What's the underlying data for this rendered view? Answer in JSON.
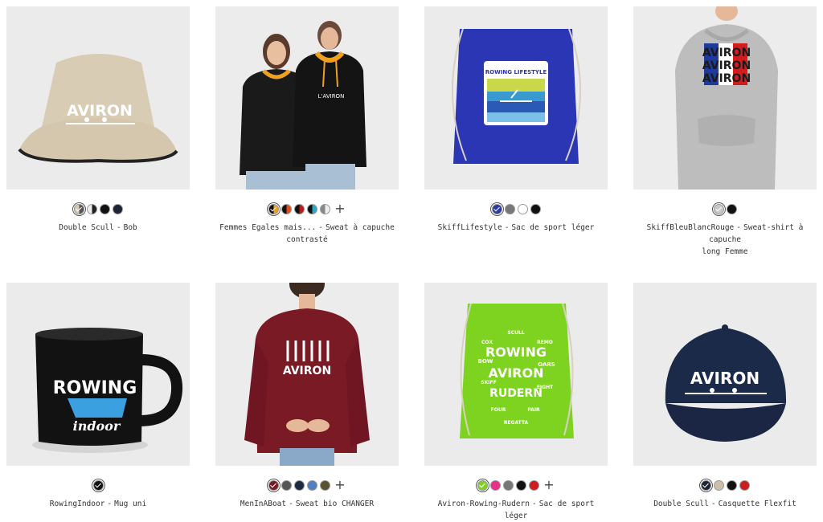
{
  "products": [
    {
      "design": "Double Scull",
      "type": "Bob",
      "swatches": [
        "#d9ccb4|#555",
        "#eee|#222",
        "#111",
        "#1c2436"
      ],
      "selected": 0,
      "more": false,
      "title_line2": ""
    },
    {
      "design": "Femmes Egales mais...",
      "type": "Sweat à capuche",
      "title_line2": "contrasté",
      "swatches": [
        "#111|#f0a020",
        "#111|#e84a1a",
        "#111|#c01818",
        "#111|#2aa8c8",
        "#888|#eee"
      ],
      "selected": 0,
      "more": true
    },
    {
      "design": "SkiffLifestyle",
      "type": "Sac de sport léger",
      "swatches": [
        "#2a3aa8",
        "#777",
        "#ffffff",
        "#111"
      ],
      "selected": 0,
      "more": false,
      "title_line2": ""
    },
    {
      "design": "SkiffBleuBlancRouge",
      "type": "Sweat-shirt à capuche",
      "title_line2": "long Femme",
      "swatches": [
        "#c8c8c8",
        "#111"
      ],
      "selected": 0,
      "more": false
    },
    {
      "design": "RowingIndoor",
      "type": "Mug uni",
      "swatches": [
        "#111"
      ],
      "selected": 0,
      "more": false,
      "title_line2": ""
    },
    {
      "design": "MenInABoat",
      "type": "Sweat bio CHANGER",
      "swatches": [
        "#7a1a24",
        "#555",
        "#1c2a44",
        "#5080c0",
        "#5a5230"
      ],
      "selected": 0,
      "more": true,
      "title_line2": ""
    },
    {
      "design": "Aviron-Rowing-Rudern",
      "type": "Sac de sport léger",
      "swatches": [
        "#7ed321",
        "#e8308a",
        "#777",
        "#111",
        "#d01c1c"
      ],
      "selected": 0,
      "more": true,
      "title_line2": ""
    },
    {
      "design": "Double Scull",
      "type": "Casquette Flexfit",
      "swatches": [
        "#1c2436",
        "#cbbfa6",
        "#111",
        "#d01c1c"
      ],
      "selected": 0,
      "more": false,
      "title_line2": ""
    }
  ],
  "artwork": {
    "bob_text": "AVIRON",
    "hoodie_print": "L'AVIRON",
    "bag_label": "ROWING LIFESTYLE",
    "dress_text": "AVIRON",
    "mug_text1": "ROWING",
    "mug_text2": "indoor",
    "sweat_text": "AVIRON",
    "green_words": [
      "ROWING",
      "AVIRON",
      "RUDERN",
      "COX",
      "REMO",
      "BOW",
      "OARS",
      "SKIFF",
      "EIGHT",
      "FOUR",
      "PAIR",
      "SCULL",
      "REGATTA"
    ],
    "cap_text": "AVIRON"
  },
  "separator": "-",
  "plus_label": "+"
}
